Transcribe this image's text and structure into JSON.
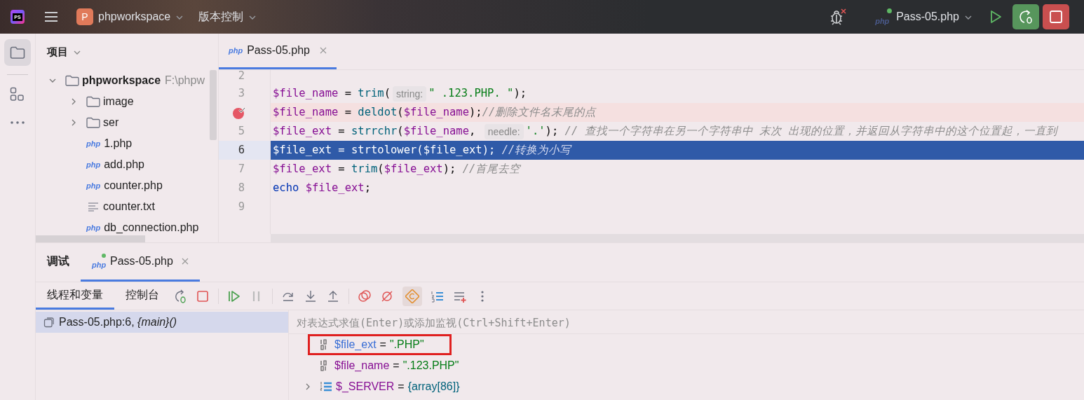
{
  "title_bar": {
    "logo": "PS",
    "project_badge": "P",
    "project": "phpworkspace",
    "vcs": "版本控制",
    "run_config_badge": "php",
    "run_config": "Pass-05.php"
  },
  "project_panel": {
    "title": "项目",
    "tree": [
      {
        "name": "phpworkspace",
        "path": "F:\\phpw",
        "kind": "folder",
        "expanded": true,
        "children": [
          {
            "name": "image",
            "kind": "folder",
            "expanded": false
          },
          {
            "name": "ser",
            "kind": "folder",
            "expanded": false
          },
          {
            "name": "1.php",
            "kind": "php",
            "badge": "php"
          },
          {
            "name": "add.php",
            "kind": "php",
            "badge": "php"
          },
          {
            "name": "counter.php",
            "kind": "php",
            "badge": "php"
          },
          {
            "name": "counter.txt",
            "kind": "text"
          },
          {
            "name": "db_connection.php",
            "kind": "php",
            "badge": "php"
          }
        ]
      }
    ]
  },
  "editor": {
    "tabs": [
      {
        "badge": "php",
        "label": "Pass-05.php",
        "selected": true
      }
    ],
    "lines": [
      {
        "number": "2",
        "breakpoint": false,
        "current": false
      },
      {
        "number": "3",
        "breakpoint": false,
        "current": false,
        "tokens": [
          {
            "kind": "var",
            "text": "$file_name"
          },
          {
            "kind": "op",
            "text": " = "
          },
          {
            "kind": "fn",
            "text": "trim"
          },
          {
            "kind": "op",
            "text": "("
          },
          {
            "kind": "hint",
            "text": "string:"
          },
          {
            "kind": "str",
            "text": "\" .123.PHP. \""
          },
          {
            "kind": "op",
            "text": ");"
          }
        ]
      },
      {
        "breakpoint": true,
        "current": false,
        "tokens": [
          {
            "kind": "var",
            "text": "$file_name"
          },
          {
            "kind": "op",
            "text": " = "
          },
          {
            "kind": "fn",
            "text": "deldot"
          },
          {
            "kind": "op",
            "text": "("
          },
          {
            "kind": "var",
            "text": "$file_name"
          },
          {
            "kind": "op",
            "text": ");"
          },
          {
            "kind": "comment",
            "text": "//删除文件名末尾的点"
          }
        ]
      },
      {
        "number": "5",
        "breakpoint": false,
        "current": false,
        "tokens": [
          {
            "kind": "var",
            "text": "$file_ext"
          },
          {
            "kind": "op",
            "text": " = "
          },
          {
            "kind": "fn",
            "text": "strrchr"
          },
          {
            "kind": "op",
            "text": "("
          },
          {
            "kind": "var",
            "text": "$file_name"
          },
          {
            "kind": "op",
            "text": ", "
          },
          {
            "kind": "hint",
            "text": "needle:"
          },
          {
            "kind": "str",
            "text": "'.'"
          },
          {
            "kind": "op",
            "text": "); "
          },
          {
            "kind": "comment",
            "text": "// 查找一个字符串在另一个字符串中 末次 出现的位置，并返回从字符串中的这个位置起，一直到"
          }
        ]
      },
      {
        "number": "6",
        "breakpoint": false,
        "current": true,
        "tokens": [
          {
            "kind": "var",
            "text": "$file_ext"
          },
          {
            "kind": "op",
            "text": " = "
          },
          {
            "kind": "fn",
            "text": "strtolower"
          },
          {
            "kind": "op",
            "text": "("
          },
          {
            "kind": "var",
            "text": "$file_ext"
          },
          {
            "kind": "op",
            "text": "); "
          },
          {
            "kind": "comment",
            "text": "//转换为小写"
          }
        ]
      },
      {
        "number": "7",
        "breakpoint": false,
        "current": false,
        "tokens": [
          {
            "kind": "var",
            "text": "$file_ext"
          },
          {
            "kind": "op",
            "text": " = "
          },
          {
            "kind": "fn",
            "text": "trim"
          },
          {
            "kind": "op",
            "text": "("
          },
          {
            "kind": "var",
            "text": "$file_ext"
          },
          {
            "kind": "op",
            "text": "); "
          },
          {
            "kind": "comment",
            "text": "//首尾去空"
          }
        ]
      },
      {
        "number": "8",
        "breakpoint": false,
        "current": false,
        "tokens": [
          {
            "kind": "kw",
            "text": "echo "
          },
          {
            "kind": "var",
            "text": "$file_ext"
          },
          {
            "kind": "op",
            "text": ";"
          }
        ]
      },
      {
        "number": "9",
        "breakpoint": false,
        "current": false
      }
    ]
  },
  "debug": {
    "tabs": [
      {
        "label": "调试",
        "selected": false
      },
      {
        "badge": "php",
        "label": "Pass-05.php",
        "selected": true
      }
    ],
    "subtabs": [
      {
        "label": "线程和变量",
        "selected": true
      },
      {
        "label": "控制台",
        "selected": false
      }
    ],
    "frames": [
      {
        "location": "Pass-05.php:6, ",
        "function": "{main}()",
        "selected": true
      }
    ],
    "evaluate_placeholder": "对表达式求值(Enter)或添加监视(Ctrl+Shift+Enter)",
    "variables": [
      {
        "kind": "scalar",
        "name": "$file_ext",
        "operator": "=",
        "value": "\".PHP\"",
        "highlighted": true,
        "expandable": false
      },
      {
        "kind": "scalar",
        "name": "$file_name",
        "operator": "=",
        "value": "\".123.PHP\"",
        "highlighted": false,
        "expandable": false
      },
      {
        "kind": "array",
        "name": "$_SERVER",
        "operator": "=",
        "value": "{array[86]}",
        "highlighted": false,
        "expandable": true
      }
    ]
  }
}
